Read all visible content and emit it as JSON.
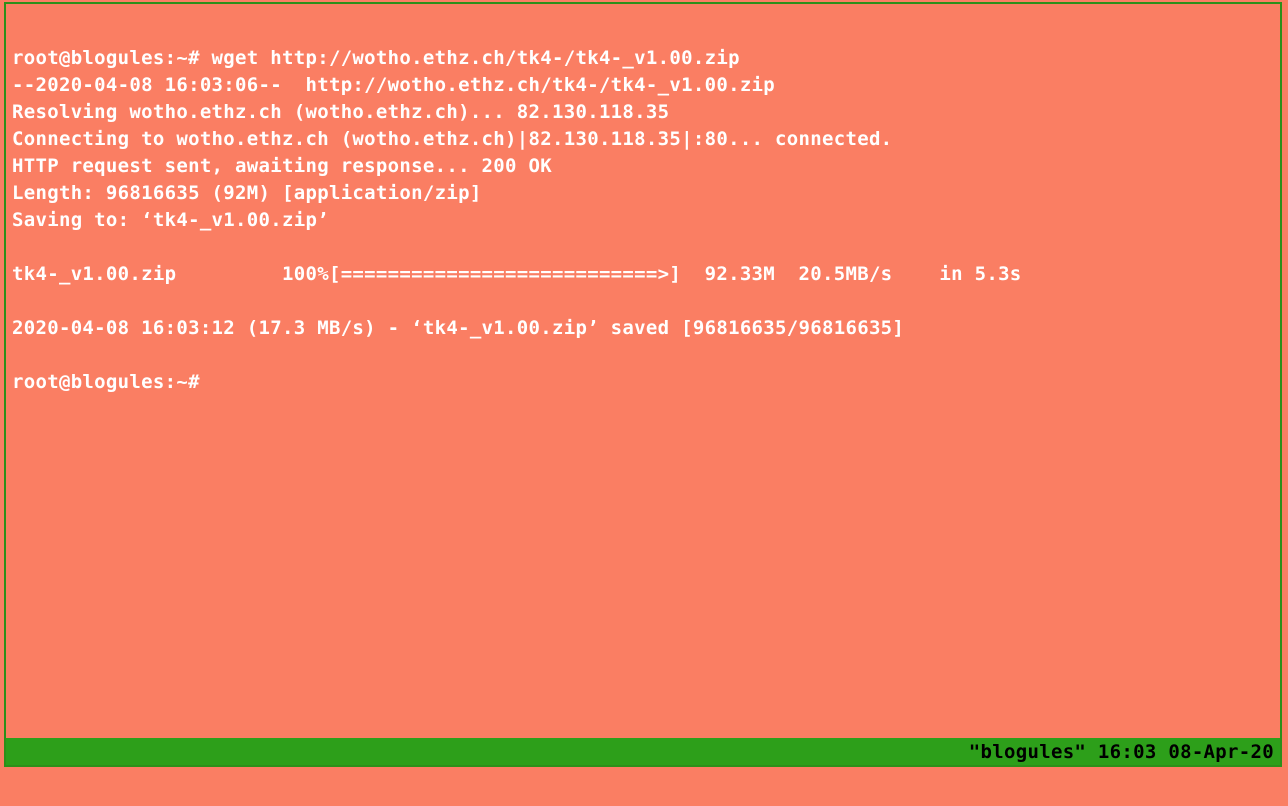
{
  "terminal": {
    "lines": [
      "root@blogules:~# wget http://wotho.ethz.ch/tk4-/tk4-_v1.00.zip",
      "--2020-04-08 16:03:06--  http://wotho.ethz.ch/tk4-/tk4-_v1.00.zip",
      "Resolving wotho.ethz.ch (wotho.ethz.ch)... 82.130.118.35",
      "Connecting to wotho.ethz.ch (wotho.ethz.ch)|82.130.118.35|:80... connected.",
      "HTTP request sent, awaiting response... 200 OK",
      "Length: 96816635 (92M) [application/zip]",
      "Saving to: ‘tk4-_v1.00.zip’",
      "",
      "tk4-_v1.00.zip         100%[===========================>]  92.33M  20.5MB/s    in 5.3s",
      "",
      "2020-04-08 16:03:12 (17.3 MB/s) - ‘tk4-_v1.00.zip’ saved [96816635/96816635]",
      "",
      "root@blogules:~#"
    ]
  },
  "status": {
    "text": "\"blogules\" 16:03 08-Apr-20"
  },
  "colors": {
    "background": "#fa7e63",
    "border": "#2d8f1a",
    "statusbar": "#2d9f1a",
    "text": "#ffffff",
    "status_text": "#000000"
  }
}
